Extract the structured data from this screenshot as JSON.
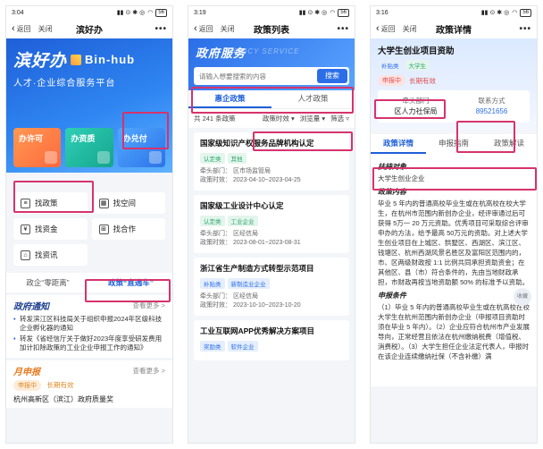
{
  "screens": [
    {
      "status": {
        "time": "3:04",
        "battery": "56"
      },
      "nav": {
        "back": "返回",
        "close": "关闭",
        "title": "滨好办",
        "more": "•••"
      },
      "brand": {
        "cn": "滨好办",
        "en": "Bin-hub",
        "slogan": "人才·企业综合服务平台"
      },
      "big_tiles": [
        "办许可",
        "办资质",
        "办兑付"
      ],
      "services": [
        "找政策",
        "找空间",
        "找资金",
        "找合作",
        "找资讯"
      ],
      "policy_tabs": [
        "政企“零距离”",
        "政策“直通车”"
      ],
      "notice": {
        "title": "政府通知",
        "more": "查看更多 >",
        "items": [
          "转发滨江区科技局关于组织申报2024年区级科技企业孵化器的通知",
          "转发《省经信厅关于做好2023年度享受研发费用加计扣除政策的工业企业申报工作的通知》"
        ]
      },
      "monthly": {
        "title": "月申报",
        "more": "查看更多 >",
        "status": "申报中",
        "deadline": "长期有效",
        "project": "杭州高新区（滨江）政府质量奖"
      }
    },
    {
      "status": {
        "time": "3:19",
        "battery": "56"
      },
      "nav": {
        "back": "返回",
        "close": "关闭",
        "title": "政策列表",
        "more": "•••"
      },
      "banner": {
        "title": "政府服务",
        "ghost": "POLICY SERVICE"
      },
      "search": {
        "placeholder": "请输入想要搜索的内容",
        "button": "搜索"
      },
      "tabs": [
        "惠企政策",
        "人才政策"
      ],
      "filter": {
        "count": "共 241 条政策",
        "f1": "政策时效 ▾",
        "f2": "浏览量 ▾",
        "f3": "筛选 ▿"
      },
      "cards": [
        {
          "title": "国家级知识产权服务品牌机构认定",
          "tags": [
            "认定类",
            "其他"
          ],
          "dept": "牵头部门：  区市场监管局",
          "date": "政策时效：  2023-04-10~2023-04-25"
        },
        {
          "title": "国家级工业设计中心认定",
          "tags": [
            "认定类",
            "工业企业"
          ],
          "dept": "牵头部门：  区经信局",
          "date": "政策时效：  2023-08-01~2023-08-31"
        },
        {
          "title": "浙江省生产制造方式转型示范项目",
          "tags": [
            "补贴类",
            "新制造业企业"
          ],
          "dept": "牵头部门：  区经信局",
          "date": "政策时效：  2023-10-10~2023-10-20"
        },
        {
          "title": "工业互联网APP优秀解决方案项目",
          "tags": [
            "奖励类",
            "软件企业"
          ],
          "dept": "",
          "date": ""
        }
      ]
    },
    {
      "status": {
        "time": "3:16",
        "battery": "56"
      },
      "nav": {
        "back": "返回",
        "close": "关闭",
        "title": "政策详情",
        "more": "•••"
      },
      "policy": {
        "title": "大学生创业项目资助",
        "tags": [
          "补贴类",
          "大学生"
        ],
        "status": "申报中",
        "deadline": "长期有效",
        "dept_label": "牵头部门",
        "dept": "区人力社保局",
        "contact_label": "联系方式",
        "contact": "89521656"
      },
      "tabs": [
        "政策详情",
        "申报指南",
        "政策解读"
      ],
      "content": {
        "target_h": "扶持对象",
        "target": "大学生创业企业",
        "policy_h": "政策内容",
        "policy": "毕业 5 年内的普通高校毕业生或在杭高校在校大学生，在杭州市范围内新创办企业，经评审通过后可获得 5万一 20 万元资助。优秀项目可采取综合评审申办的方法，给予最高 50万元的资助。对上述大学生创业项目在上城区、拱墅区、西湖区、滨江区、钱塘区、杭州西湖风景名胜区及富阳区范围内的，市、区两级财政按 1:1 比例共同承担资助资金；在其他区、县（市）符合条件的，先由当地财政承担，市财政再按当地资助额 50% 的标准予以资助。",
        "cond_h": "申报条件",
        "cond": "（1）毕业 5 年内的普通高校毕业生或在杭高校在校大学生在杭州范围内新创办企业（申报项目资助时须在毕业 5 年内）。（2）企业应符合杭州市产业发展导向，正常经营且依法在杭州缴纳税费（增值税、消费税）。（3）大学生担任企业法定代表人，申报时在该企业连续缴纳社保（不含补缴）满",
        "collapse": "收藏"
      }
    }
  ]
}
